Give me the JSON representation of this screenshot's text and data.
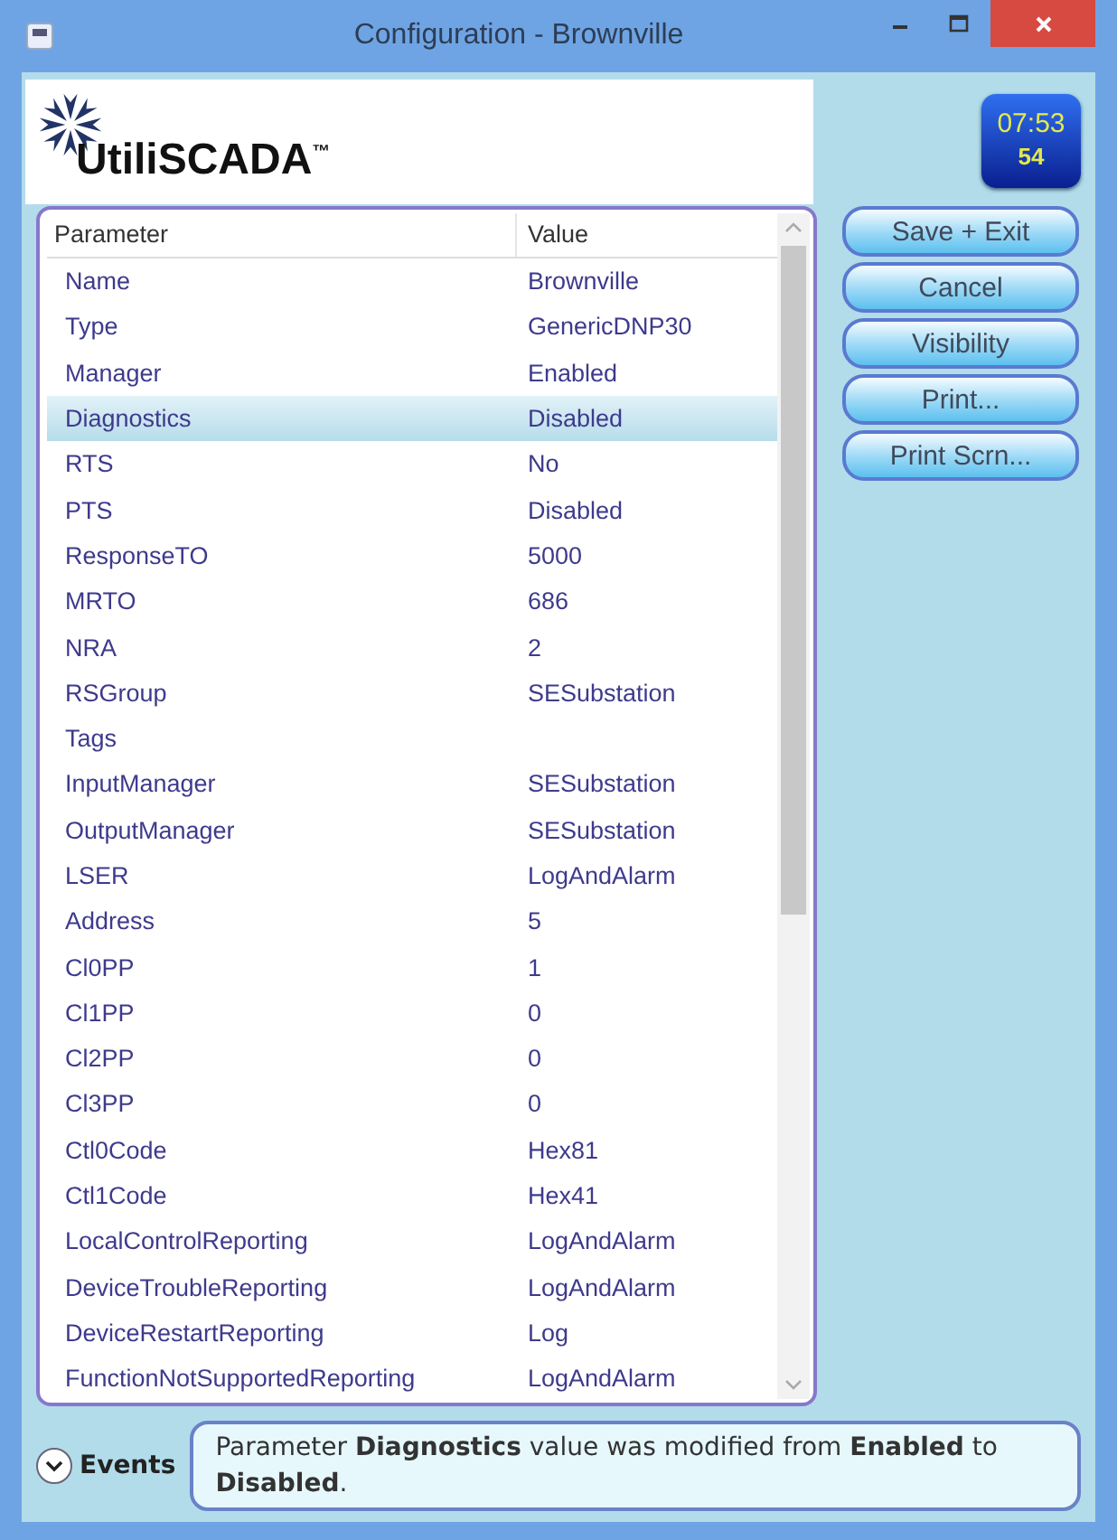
{
  "window": {
    "title": "Configuration - Brownville"
  },
  "logo": {
    "text": "UtiliSCADA$^{™}$"
  },
  "clock": {
    "time": "07:53",
    "seconds": "54"
  },
  "table": {
    "columns": [
      "Parameter",
      "Value"
    ],
    "rows": [
      {
        "parameter": "Name",
        "value": "Brownville",
        "selected": false
      },
      {
        "parameter": "Type",
        "value": "GenericDNP30",
        "selected": false
      },
      {
        "parameter": "Manager",
        "value": "Enabled",
        "selected": false
      },
      {
        "parameter": "Diagnostics",
        "value": "Disabled",
        "selected": true
      },
      {
        "parameter": "RTS",
        "value": "No",
        "selected": false
      },
      {
        "parameter": "PTS",
        "value": "Disabled",
        "selected": false
      },
      {
        "parameter": "ResponseTO",
        "value": "5000",
        "selected": false
      },
      {
        "parameter": "MRTO",
        "value": "686",
        "selected": false
      },
      {
        "parameter": "NRA",
        "value": "2",
        "selected": false
      },
      {
        "parameter": "RSGroup",
        "value": "SESubstation",
        "selected": false
      },
      {
        "parameter": "Tags",
        "selected": false
      },
      {
        "parameter": "InputManager",
        "value": "SESubstation",
        "selected": false
      },
      {
        "parameter": "OutputManager",
        "value": "SESubstation",
        "selected": false
      },
      {
        "parameter": "LSER",
        "value": "LogAndAlarm",
        "selected": false
      },
      {
        "parameter": "Address",
        "value": "5",
        "selected": false
      },
      {
        "parameter": "Cl0PP",
        "value": "1",
        "selected": false
      },
      {
        "parameter": "Cl1PP",
        "value": "0",
        "selected": false
      },
      {
        "parameter": "Cl2PP",
        "value": "0",
        "selected": false
      },
      {
        "parameter": "Cl3PP",
        "value": "0",
        "selected": false
      },
      {
        "parameter": "Ctl0Code",
        "value": "Hex81",
        "selected": false
      },
      {
        "parameter": "Ctl1Code",
        "value": "Hex41",
        "selected": false
      },
      {
        "parameter": "LocalControlReporting",
        "value": "LogAndAlarm",
        "selected": false
      },
      {
        "parameter": "DeviceTroubleReporting",
        "value": "LogAndAlarm",
        "selected": false
      },
      {
        "parameter": "DeviceRestartReporting",
        "value": "Log",
        "selected": false
      },
      {
        "parameter": "FunctionNotSupportedReporting",
        "value": "LogAndAlarm",
        "selected": false
      }
    ]
  },
  "buttons": [
    "Save + Exit",
    "Cancel",
    "Visibility",
    "Print...",
    "Print Scrn..."
  ],
  "events": {
    "label": "Events",
    "expanded": false,
    "message": "Parameter **Diagnostics** value was modified from **Enabled** to **Disabled**."
  }
}
